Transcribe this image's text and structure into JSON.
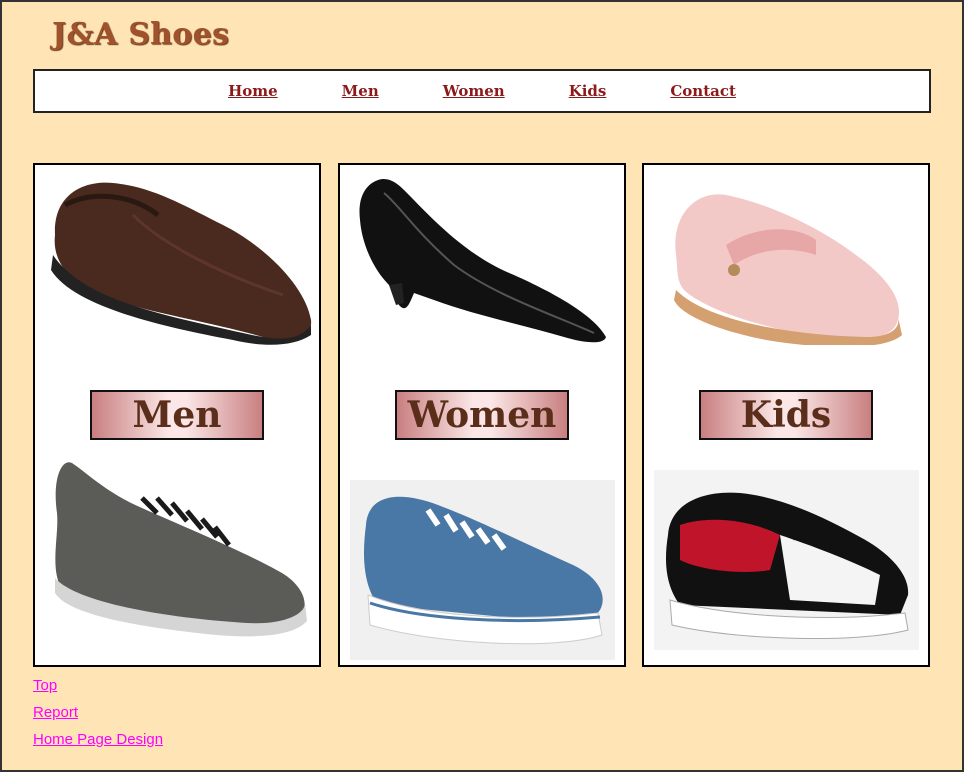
{
  "site": {
    "title": "J&A Shoes"
  },
  "nav": {
    "items": [
      "Home",
      "Men",
      "Women",
      "Kids",
      "Contact"
    ]
  },
  "categories": [
    {
      "label": "Men"
    },
    {
      "label": "Women"
    },
    {
      "label": "Kids"
    }
  ],
  "footer": {
    "links": [
      "Top",
      "Report",
      "Home Page Design"
    ]
  },
  "colors": {
    "background": "#ffe5b6",
    "title": "#a0522d",
    "nav_link": "#8b1a1a",
    "footer_link": "#ff00ff",
    "label_text": "#5a2e1a"
  }
}
